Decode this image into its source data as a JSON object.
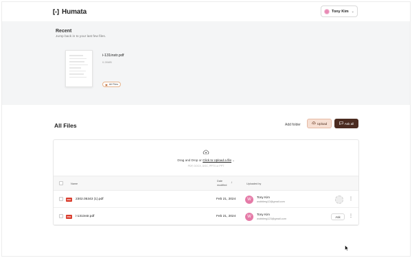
{
  "app": {
    "name": "Humata"
  },
  "header": {
    "user_name": "Tony Kim"
  },
  "recent": {
    "title": "Recent",
    "subtitle": "Jump back in to your last few files.",
    "file": {
      "name": "i-131instr.pdf",
      "size": "0.26MB",
      "folder_badge": "All Files"
    }
  },
  "all_files": {
    "title": "All Files",
    "add_folder": "Add folder",
    "upload_label": "Upload",
    "ask_all_label": "Ask all"
  },
  "dropzone": {
    "text_prefix": "Drag and Drop or ",
    "link_text": "Click to Upload a file",
    "types": "PDF, DOCX, DOC, PPTX or PPT"
  },
  "table": {
    "columns": {
      "name": "Name",
      "date_line1": "Date",
      "date_line2": "modified",
      "uploaded_by": "Uploaded by"
    },
    "rows": [
      {
        "name": "2302.05343 (1).pdf",
        "date": "Feb 21, 2024",
        "user_initial": "W",
        "user_name": "Tony Kim",
        "user_email": "wobblerg12@gmail.com",
        "action": ""
      },
      {
        "name": "i-131instr.pdf",
        "date": "Feb 21, 2024",
        "user_initial": "W",
        "user_name": "Tony Kim",
        "user_email": "wobblerg123@gmail.com",
        "action": "Ask"
      }
    ]
  },
  "icons": {
    "pdf_badge": "PDF",
    "logo": "humata-logo-icon",
    "upload": "cloud-upload-icon",
    "ask_all": "chat-bubble-icon",
    "kebab": "more-vertical-icon"
  },
  "colors": {
    "accent_dark": "#4b2b20",
    "accent_light": "#f6dfd3",
    "avatar_pink": "#e57aa7",
    "pdf_red": "#d93b2b"
  }
}
